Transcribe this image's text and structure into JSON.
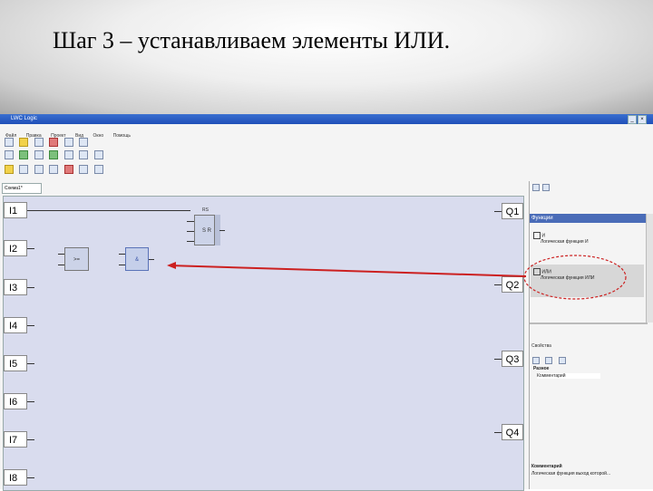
{
  "slide": {
    "title": "Шаг 3 – устанавливаем элементы ИЛИ."
  },
  "app": {
    "window_title": "LWC Logic",
    "menu": [
      "Файл",
      "Правка",
      "Проект",
      "Вид",
      "Окно",
      "Помощь"
    ],
    "document_tab": "Схема1*",
    "inputs": [
      "I1",
      "I2",
      "I3",
      "I4",
      "I5",
      "I6",
      "I7",
      "I8"
    ],
    "outputs": [
      "Q1",
      "Q2",
      "Q3",
      "Q4"
    ],
    "blocks": {
      "rs_header": "RS",
      "rs_label": "S R",
      "block1": ">=",
      "block2": "&"
    },
    "functions_panel": {
      "title": "Функции",
      "items": [
        {
          "name": "И",
          "desc": "Логическая функция И"
        },
        {
          "name": "ИЛИ",
          "desc": "Логическая функция ИЛИ"
        }
      ]
    },
    "properties_panel": {
      "title": "Свойства",
      "group": "Разное",
      "field": "Комментарий"
    },
    "comment_panel": {
      "title": "Комментарий",
      "text": "Логическая функция выход которой..."
    }
  },
  "colors": {
    "arrow": "#cc2020",
    "ellipse": "#cc2020",
    "canvas": "#d9dcee",
    "panel_title": "#4a6cb8"
  }
}
